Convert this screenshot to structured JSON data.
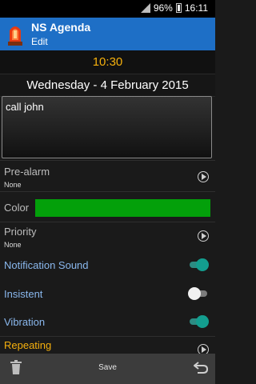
{
  "status_bar": {
    "battery_percent": "96%",
    "time": "16:11"
  },
  "app_bar": {
    "title": "NS Agenda",
    "subtitle": "Edit",
    "icon": "alarm-siren-icon"
  },
  "event": {
    "time": "10:30",
    "date": "Wednesday - 4 February 2015",
    "note": "call john"
  },
  "settings": {
    "pre_alarm": {
      "label": "Pre-alarm",
      "value": "None"
    },
    "color": {
      "label": "Color",
      "value": "#03a00a"
    },
    "priority": {
      "label": "Priority",
      "value": "None"
    },
    "notification_sound": {
      "label": "Notification Sound",
      "enabled": true
    },
    "insistent": {
      "label": "Insistent",
      "enabled": false
    },
    "vibration": {
      "label": "Vibration",
      "enabled": true
    },
    "repeating": {
      "label": "Repeating"
    }
  },
  "bottom_bar": {
    "save_label": "Save",
    "delete_icon": "trash-icon",
    "back_icon": "back-arrow-icon"
  },
  "colors": {
    "accent_blue": "#1e6fc6",
    "time_orange": "#f5b00d",
    "toggle_on": "#139e8f"
  }
}
